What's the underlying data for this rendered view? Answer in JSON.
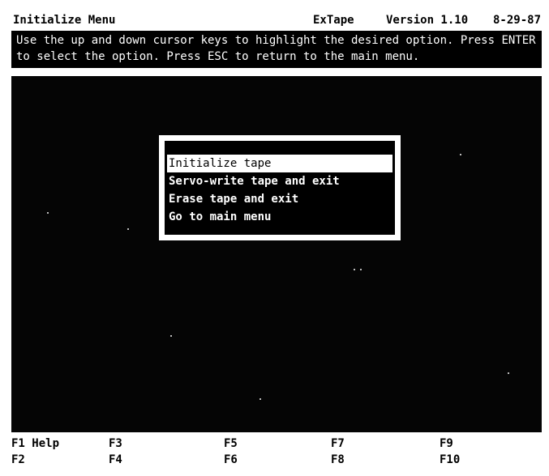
{
  "header": {
    "title": "Initialize Menu",
    "app_name": "ExTape",
    "version": "Version 1.10",
    "date": "8-29-87"
  },
  "instructions": {
    "line1": "Use the up and down cursor keys to highlight the desired option. Press ENTER",
    "line2": "to select the option. Press ESC to return to the main menu."
  },
  "menu": {
    "items": [
      {
        "label": "Initialize tape",
        "selected": true
      },
      {
        "label": "Servo-write tape and exit",
        "selected": false
      },
      {
        "label": "Erase tape and exit",
        "selected": false
      },
      {
        "label": "Go to main menu",
        "selected": false
      }
    ]
  },
  "function_keys": {
    "f1": "F1 Help",
    "f2": "F2",
    "f3": "F3",
    "f4": "F4",
    "f5": "F5",
    "f6": "F6",
    "f7": "F7",
    "f8": "F8",
    "f9": "F9",
    "f10": "F10"
  },
  "colors": {
    "background": "#000000",
    "foreground": "#ffffff",
    "highlight": "#ffffff"
  }
}
